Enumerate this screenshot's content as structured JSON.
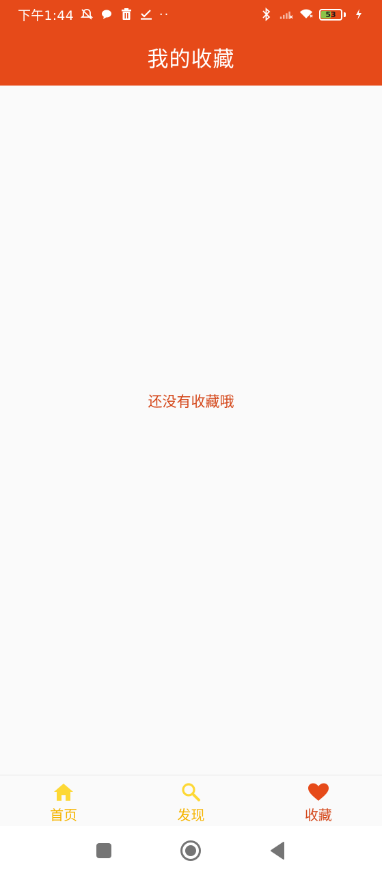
{
  "status_bar": {
    "time": "下午1:44",
    "battery": "53",
    "battery_level": 0.53,
    "icons": [
      "mute-icon",
      "chat-bubble-icon",
      "trash-icon",
      "checkmark-icon",
      "more-dots-icon",
      "bluetooth-icon",
      "signal-icon",
      "wifi-icon",
      "battery-icon",
      "charging-icon"
    ],
    "dots": "··"
  },
  "app_bar": {
    "title": "我的收藏"
  },
  "content": {
    "empty_message": "还没有收藏哦"
  },
  "bottom_nav": {
    "items": [
      {
        "label": "首页",
        "icon": "home-icon",
        "active": false
      },
      {
        "label": "发现",
        "icon": "search-icon",
        "active": false
      },
      {
        "label": "收藏",
        "icon": "heart-icon",
        "active": true
      }
    ]
  },
  "system_nav": {
    "buttons": [
      "recents-button",
      "home-button",
      "back-button"
    ]
  },
  "colors": {
    "primary": "#e64a19",
    "active": "#d4471a",
    "inactive": "#f5b400",
    "background": "#fafafa"
  }
}
